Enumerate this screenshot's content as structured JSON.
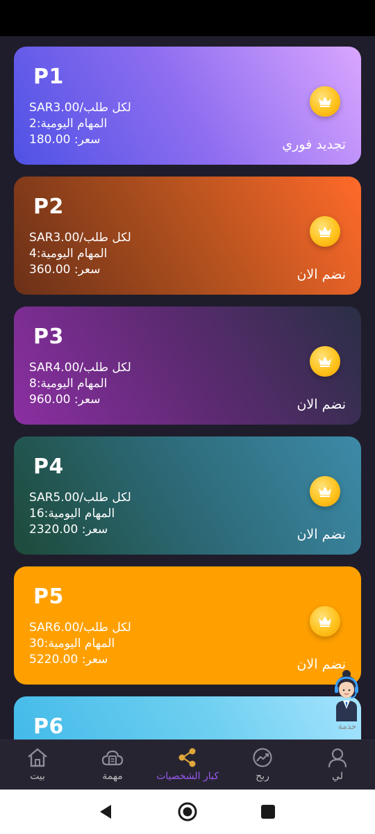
{
  "plans": [
    {
      "name": "P1",
      "per_order": "SAR3.00/لكل طلب",
      "daily_tasks": "المهام اليومية:2",
      "price": "سعر: 180.00",
      "action": "تجديد فوري"
    },
    {
      "name": "P2",
      "per_order": "SAR3.00/لكل طلب",
      "daily_tasks": "المهام اليومية:4",
      "price": "سعر: 360.00",
      "action": "نضم الان"
    },
    {
      "name": "P3",
      "per_order": "SAR4.00/لكل طلب",
      "daily_tasks": "المهام اليومية:8",
      "price": "سعر: 960.00",
      "action": "نضم الان"
    },
    {
      "name": "P4",
      "per_order": "SAR5.00/لكل طلب",
      "daily_tasks": "المهام اليومية:16",
      "price": "سعر: 2320.00",
      "action": "نضم الان"
    },
    {
      "name": "P5",
      "per_order": "SAR6.00/لكل طلب",
      "daily_tasks": "المهام اليومية:30",
      "price": "سعر: 5220.00",
      "action": "نضم الان"
    },
    {
      "name": "P6"
    }
  ],
  "support": {
    "label": "خدمة",
    "icon": "customer-service-agent-icon"
  },
  "bottom_nav": [
    {
      "label": "بيت",
      "icon": "home-icon"
    },
    {
      "label": "مهمة",
      "icon": "task-cloud-icon"
    },
    {
      "label": "كبار الشخصيات",
      "icon": "share-icon",
      "active": true
    },
    {
      "label": "ربح",
      "icon": "trend-chart-icon"
    },
    {
      "label": "لي",
      "icon": "user-icon"
    }
  ],
  "colors": {
    "active": "#9b59f0",
    "inactive": "#bcbcbc",
    "badge": "#ffc21c"
  }
}
